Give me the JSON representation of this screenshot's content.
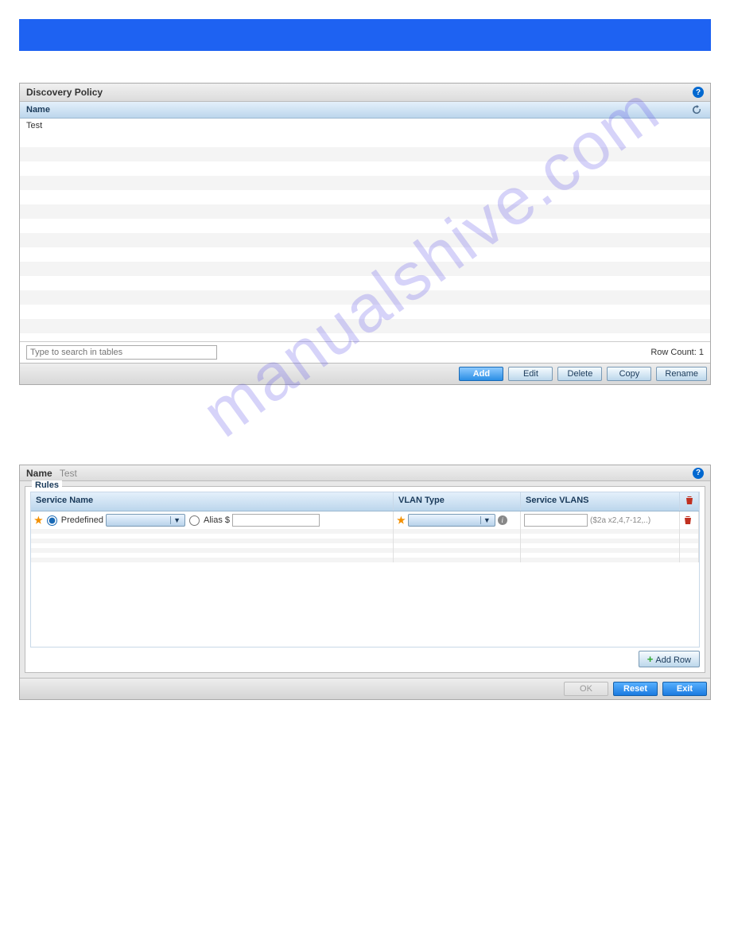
{
  "watermark": "manualshive.com",
  "panel1": {
    "title": "Discovery Policy",
    "col_name": "Name",
    "rows": [
      "Test"
    ],
    "search_placeholder": "Type to search in tables",
    "rowcount_label": "Row Count:",
    "rowcount_value": "1",
    "buttons": {
      "add": "Add",
      "edit": "Edit",
      "delete": "Delete",
      "copy": "Copy",
      "rename": "Rename"
    }
  },
  "panel2": {
    "name_label": "Name",
    "name_value": "Test",
    "rules_label": "Rules",
    "cols": {
      "svc": "Service Name",
      "vlan": "VLAN Type",
      "svlans": "Service VLANS"
    },
    "row": {
      "predefined": "Predefined",
      "alias": "Alias",
      "alias_prefix": "$",
      "svlans_hint": "($2a x2,4,7-12,..)"
    },
    "addrow": "Add Row",
    "footer": {
      "ok": "OK",
      "reset": "Reset",
      "exit": "Exit"
    }
  }
}
